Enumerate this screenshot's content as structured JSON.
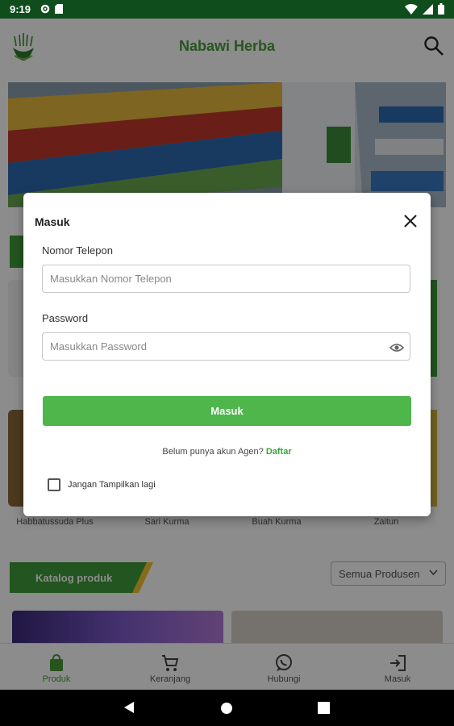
{
  "status_bar": {
    "time": "9:19"
  },
  "app_bar": {
    "title": "Nabawi Herba"
  },
  "categories": [
    {
      "label": "Habbatussuda Plus"
    },
    {
      "label": "Sari Kurma"
    },
    {
      "label": "Buah Kurma"
    },
    {
      "label": "Zaitun"
    }
  ],
  "catalog": {
    "title": "Katalog produk",
    "filter_value": "Semua Produsen"
  },
  "bottom_nav": [
    {
      "label": "Produk",
      "active": true
    },
    {
      "label": "Keranjang",
      "active": false
    },
    {
      "label": "Hubungi",
      "active": false
    },
    {
      "label": "Masuk",
      "active": false
    }
  ],
  "dialog": {
    "title": "Masuk",
    "phone_label": "Nomor Telepon",
    "phone_placeholder": "Masukkan Nomor Telepon",
    "password_label": "Password",
    "password_placeholder": "Masukkan Password",
    "login_button": "Masuk",
    "register_prompt": "Belum punya akun Agen?",
    "register_link": "Daftar",
    "dont_show_label": "Jangan Tampilkan lagi"
  },
  "colors": {
    "brand_green": "#4a9b3a",
    "button_green": "#4eb64a",
    "status_bar": "#0f4d1c"
  }
}
